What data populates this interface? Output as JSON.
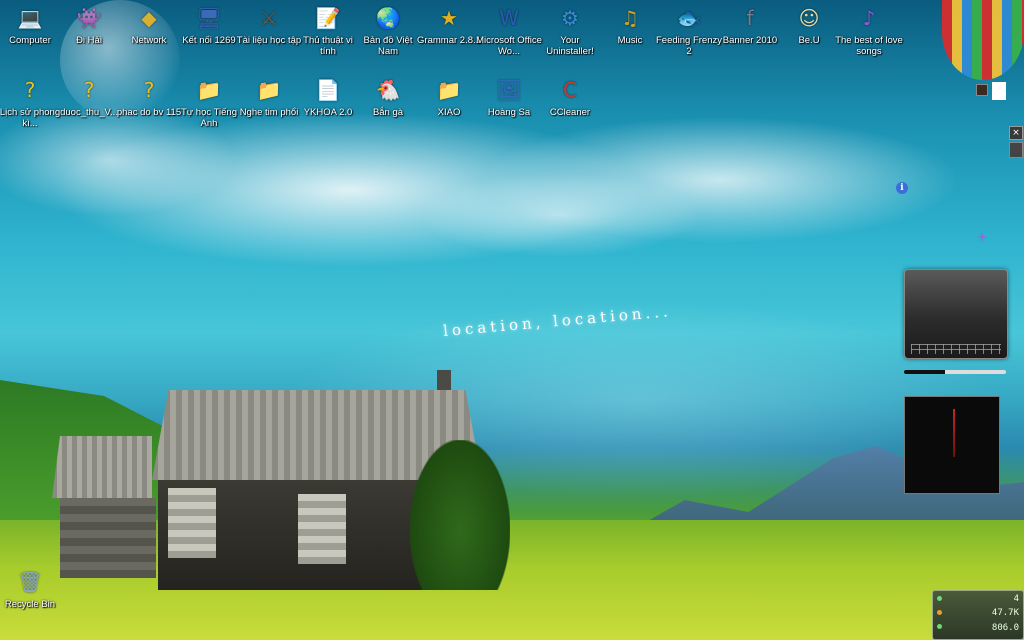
{
  "desktop": {
    "wallpaper_text": "location, location..."
  },
  "icons": [
    {
      "name": "computer",
      "label": "Computer",
      "glyph": "💻",
      "color": "#8a7a5a"
    },
    {
      "name": "di-hai",
      "label": "Đi Hải",
      "glyph": "👾",
      "color": "#c24a2a"
    },
    {
      "name": "network",
      "label": "Network",
      "glyph": "◆",
      "color": "#d8b030"
    },
    {
      "name": "ket-noi",
      "label": "Kết nối 1269",
      "glyph": "🖥",
      "color": "#3a6ab8"
    },
    {
      "name": "tai-lieu",
      "label": "Tài liệu học tập",
      "glyph": "⚔",
      "color": "#6a5a4a"
    },
    {
      "name": "thu-thuat",
      "label": "Thủ thuật vi tính",
      "glyph": "📝",
      "color": "#c87a3a"
    },
    {
      "name": "ban-do",
      "label": "Bản đồ Việt Nam",
      "glyph": "🌏",
      "color": "#e09030"
    },
    {
      "name": "grammar",
      "label": "Grammar 2.8.1",
      "glyph": "★",
      "color": "#e0b020"
    },
    {
      "name": "office",
      "label": "Microsoft Office Wo...",
      "glyph": "W",
      "color": "#2a5ab0"
    },
    {
      "name": "uninstaller",
      "label": "Your Uninstaller!",
      "glyph": "⚙",
      "color": "#3a8ad8"
    },
    {
      "name": "music",
      "label": "Music",
      "glyph": "♫",
      "color": "#c8a030"
    },
    {
      "name": "feeding-frenzy",
      "label": "Feeding Frenzy 2",
      "glyph": "🐟",
      "color": "#2a8ac0"
    },
    {
      "name": "banner",
      "label": "Banner 2010",
      "glyph": "f",
      "color": "#7a7a8a"
    },
    {
      "name": "beu",
      "label": "Be.U",
      "glyph": "☺",
      "color": "#e8d8a0"
    },
    {
      "name": "love-songs",
      "label": "The best of love songs",
      "glyph": "♪",
      "color": "#8a5ad8"
    },
    {
      "name": "lich-su",
      "label": "Lịch sử phong kì...",
      "glyph": "?",
      "color": "#e8c020"
    },
    {
      "name": "duoc-thu",
      "label": "duoc_thu_V...",
      "glyph": "?",
      "color": "#e8c020"
    },
    {
      "name": "phac-do",
      "label": "phac do bv 115",
      "glyph": "?",
      "color": "#e8c020"
    },
    {
      "name": "tu-hoc",
      "label": "Tự học Tiếng Anh",
      "glyph": "📁",
      "color": "#e8c040"
    },
    {
      "name": "nghe-tim",
      "label": "Nghe tim phổi",
      "glyph": "📁",
      "color": "#e8c040"
    },
    {
      "name": "ykhoa",
      "label": "YKHOA 2.0",
      "glyph": "📄",
      "color": "#d8d8d8"
    },
    {
      "name": "ban-ga",
      "label": "Bắn gà",
      "glyph": "🐔",
      "color": "#3a7a3a"
    },
    {
      "name": "xiao",
      "label": "XIAO",
      "glyph": "📁",
      "color": "#e8c040"
    },
    {
      "name": "hoang-sa",
      "label": "Hoàng Sa",
      "glyph": "🖼",
      "color": "#3a6ac8"
    },
    {
      "name": "ccleaner",
      "label": "CCleaner",
      "glyph": "C",
      "color": "#c83a2a"
    },
    {
      "name": "recycle-bin",
      "label": "Recycle Bin",
      "glyph": "🗑",
      "color": "#8aa8c8"
    }
  ],
  "gadgets": {
    "close_glyph": "×",
    "info_glyph": "i",
    "plus_glyph": "+"
  },
  "sys_meter": {
    "line1": "4",
    "line2": "47.7K",
    "line3": "806.0"
  }
}
